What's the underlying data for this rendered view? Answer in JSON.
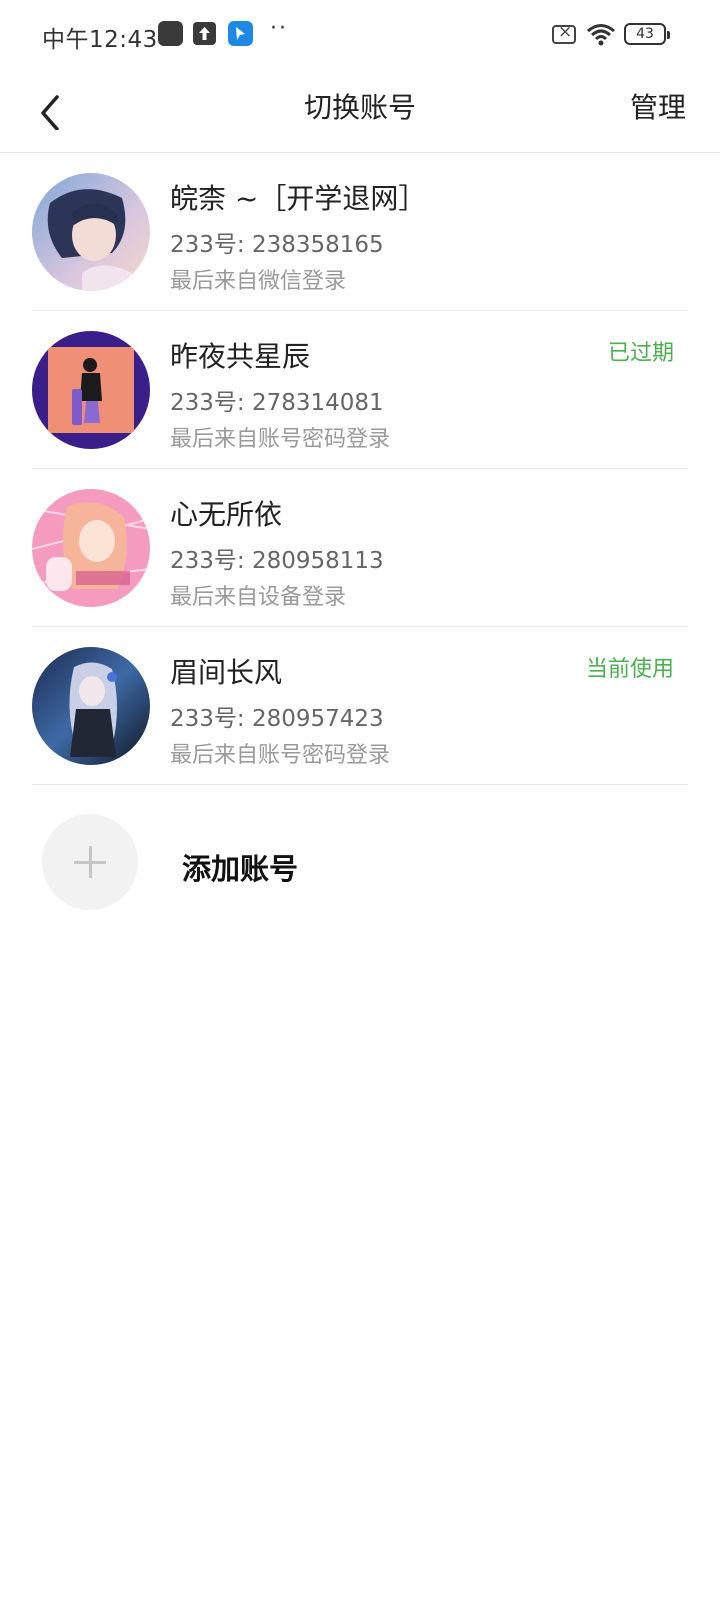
{
  "status_bar": {
    "time": "中午12:43",
    "dots": "··",
    "battery": "43",
    "icons": [
      "app-icon",
      "upload-icon",
      "app-blue-icon",
      "sim-off-icon",
      "wifi-icon",
      "battery-icon"
    ]
  },
  "header": {
    "back_icon": "chevron-left-icon",
    "title": "切换账号",
    "manage_label": "管理"
  },
  "accounts": [
    {
      "name": "皖柰 ~［开学退网］",
      "id_text": "233号: 238358165",
      "login_text": "最后来自微信登录",
      "status": "",
      "avatar": "anime-girl-avatar"
    },
    {
      "name": "昨夜共星辰",
      "id_text": "233号: 278314081",
      "login_text": "最后来自账号密码登录",
      "status": "已过期",
      "avatar": "silhouette-avatar"
    },
    {
      "name": "心无所依",
      "id_text": "233号: 280958113",
      "login_text": "最后来自设备登录",
      "status": "",
      "avatar": "pink-anime-avatar"
    },
    {
      "name": "眉间长风",
      "id_text": "233号: 280957423",
      "login_text": "最后来自账号密码登录",
      "status": "当前使用",
      "avatar": "dark-anime-avatar"
    }
  ],
  "add_account": {
    "label": "添加账号",
    "icon": "plus-icon"
  },
  "colors": {
    "status_green": "#4caf50",
    "divider": "#ececec"
  }
}
